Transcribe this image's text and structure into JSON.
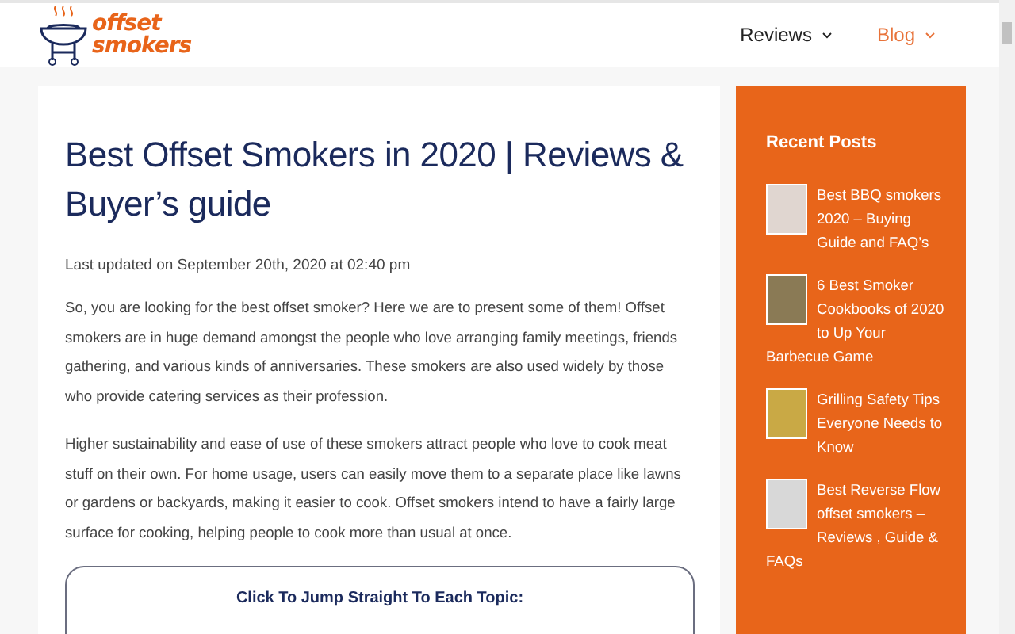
{
  "logo": {
    "line_1": "offset",
    "line_2": "smokers"
  },
  "nav": [
    {
      "label": "Reviews",
      "selected": false
    },
    {
      "label": "Blog",
      "selected": true
    }
  ],
  "article": {
    "title": "Best Offset Smokers in 2020 | Reviews & Buyer’s guide",
    "updated": "Last updated on September 20th, 2020 at 02:40 pm",
    "paragraphs": [
      "So, you are looking for the best offset smoker? Here we are to present some of them! Offset smokers are in huge demand amongst the people who love arranging family meetings, friends gathering, and various kinds of anniversaries. These smokers are also used widely by those who provide catering services as their profession.",
      "Higher sustainability and ease of use of these smokers attract people who love to cook meat stuff on their own. For home usage, users can easily move them to a separate place like lawns or gardens or backyards, making it easier to cook. Offset smokers intend to have a fairly large surface for cooking, helping people to cook more than usual at once."
    ],
    "toc_title": "Click To Jump Straight To Each Topic:"
  },
  "sidebar": {
    "title": "Recent Posts",
    "posts": [
      {
        "title": "Best BBQ smokers 2020 – Buying Guide and FAQ’s"
      },
      {
        "title": "6 Best Smoker Cookbooks of 2020 to Up Your Barbecue Game"
      },
      {
        "title": "Grilling Safety Tips Everyone Needs to Know"
      },
      {
        "title": "Best Reverse Flow offset smokers – Reviews , Guide & FAQs"
      }
    ]
  }
}
